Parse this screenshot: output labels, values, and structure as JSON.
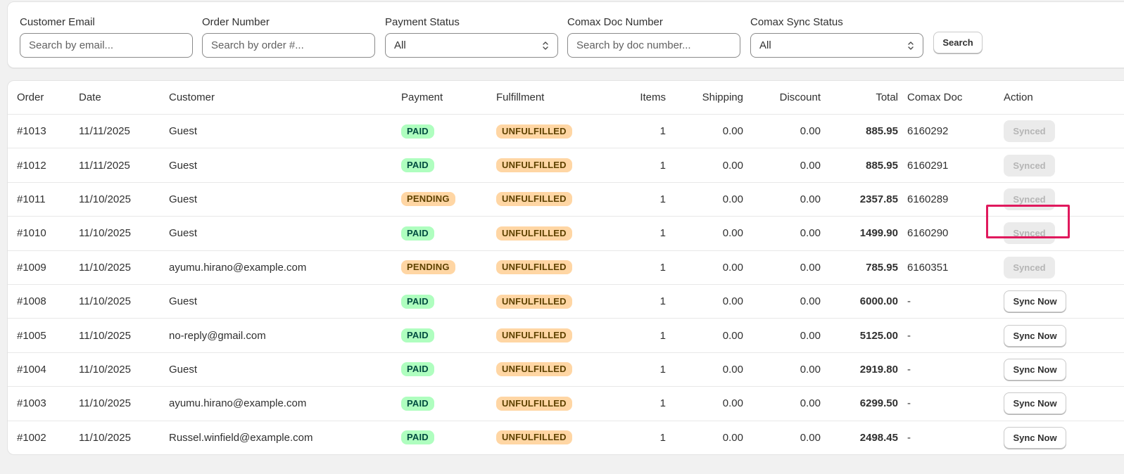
{
  "filters": {
    "email": {
      "label": "Customer Email",
      "placeholder": "Search by email..."
    },
    "order": {
      "label": "Order Number",
      "placeholder": "Search by order #..."
    },
    "payment": {
      "label": "Payment Status",
      "value": "All"
    },
    "doc": {
      "label": "Comax Doc Number",
      "placeholder": "Search by doc number..."
    },
    "sync": {
      "label": "Comax Sync Status",
      "value": "All"
    },
    "search_label": "Search"
  },
  "table": {
    "headers": {
      "order": "Order",
      "date": "Date",
      "customer": "Customer",
      "payment": "Payment",
      "fulfillment": "Fulfillment",
      "items": "Items",
      "shipping": "Shipping",
      "discount": "Discount",
      "total": "Total",
      "doc": "Comax Doc",
      "action": "Action"
    },
    "rows": [
      {
        "order": "#1013",
        "date": "11/11/2025",
        "customer": "Guest",
        "payment": "PAID",
        "fulfillment": "UNFULFILLED",
        "items": "1",
        "shipping": "0.00",
        "discount": "0.00",
        "total": "885.95",
        "doc": "6160292",
        "action": "Synced"
      },
      {
        "order": "#1012",
        "date": "11/11/2025",
        "customer": "Guest",
        "payment": "PAID",
        "fulfillment": "UNFULFILLED",
        "items": "1",
        "shipping": "0.00",
        "discount": "0.00",
        "total": "885.95",
        "doc": "6160291",
        "action": "Synced"
      },
      {
        "order": "#1011",
        "date": "11/10/2025",
        "customer": "Guest",
        "payment": "PENDING",
        "fulfillment": "UNFULFILLED",
        "items": "1",
        "shipping": "0.00",
        "discount": "0.00",
        "total": "2357.85",
        "doc": "6160289",
        "action": "Synced"
      },
      {
        "order": "#1010",
        "date": "11/10/2025",
        "customer": "Guest",
        "payment": "PAID",
        "fulfillment": "UNFULFILLED",
        "items": "1",
        "shipping": "0.00",
        "discount": "0.00",
        "total": "1499.90",
        "doc": "6160290",
        "action": "Synced"
      },
      {
        "order": "#1009",
        "date": "11/10/2025",
        "customer": "ayumu.hirano@example.com",
        "payment": "PENDING",
        "fulfillment": "UNFULFILLED",
        "items": "1",
        "shipping": "0.00",
        "discount": "0.00",
        "total": "785.95",
        "doc": "6160351",
        "action": "Synced"
      },
      {
        "order": "#1008",
        "date": "11/10/2025",
        "customer": "Guest",
        "payment": "PAID",
        "fulfillment": "UNFULFILLED",
        "items": "1",
        "shipping": "0.00",
        "discount": "0.00",
        "total": "6000.00",
        "doc": "-",
        "action": "Sync Now"
      },
      {
        "order": "#1005",
        "date": "11/10/2025",
        "customer": "no-reply@gmail.com",
        "payment": "PAID",
        "fulfillment": "UNFULFILLED",
        "items": "1",
        "shipping": "0.00",
        "discount": "0.00",
        "total": "5125.00",
        "doc": "-",
        "action": "Sync Now"
      },
      {
        "order": "#1004",
        "date": "11/10/2025",
        "customer": "Guest",
        "payment": "PAID",
        "fulfillment": "UNFULFILLED",
        "items": "1",
        "shipping": "0.00",
        "discount": "0.00",
        "total": "2919.80",
        "doc": "-",
        "action": "Sync Now"
      },
      {
        "order": "#1003",
        "date": "11/10/2025",
        "customer": "ayumu.hirano@example.com",
        "payment": "PAID",
        "fulfillment": "UNFULFILLED",
        "items": "1",
        "shipping": "0.00",
        "discount": "0.00",
        "total": "6299.50",
        "doc": "-",
        "action": "Sync Now"
      },
      {
        "order": "#1002",
        "date": "11/10/2025",
        "customer": "Russel.winfield@example.com",
        "payment": "PAID",
        "fulfillment": "UNFULFILLED",
        "items": "1",
        "shipping": "0.00",
        "discount": "0.00",
        "total": "2498.45",
        "doc": "-",
        "action": "Sync Now"
      }
    ]
  },
  "colors": {
    "paid_bg": "#affebf",
    "pending_bg": "#ffd6a4",
    "highlight": "#e0195d"
  },
  "icons": {
    "select_chevron": "chevron-up-down-icon"
  }
}
